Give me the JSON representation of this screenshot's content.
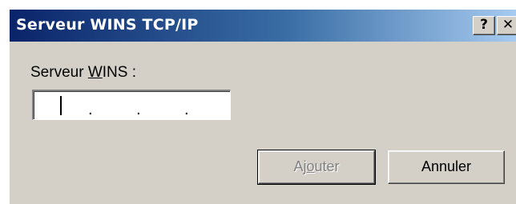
{
  "window": {
    "title": "Serveur WINS TCP/IP",
    "help_glyph": "?",
    "close_glyph": "✕"
  },
  "field": {
    "label_before": "Serveur ",
    "label_mnemonic": "W",
    "label_after": "INS :",
    "ip_value": "",
    "ip_separator": "."
  },
  "buttons": {
    "add": {
      "before": "Aj",
      "mnemonic": "o",
      "after": "uter",
      "enabled": false
    },
    "cancel": {
      "label": "Annuler"
    }
  }
}
